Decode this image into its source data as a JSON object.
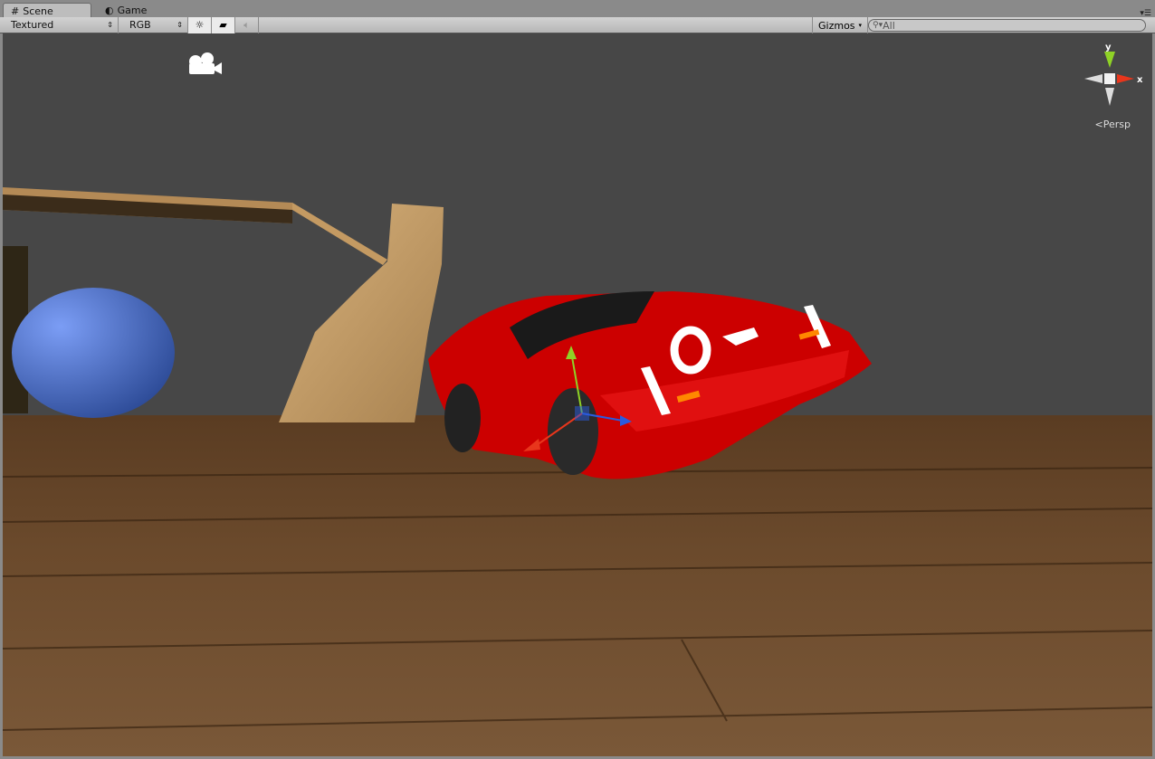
{
  "tabs": [
    {
      "label": "Scene",
      "icon": "grid-icon",
      "active": true
    },
    {
      "label": "Game",
      "icon": "pacman-icon",
      "active": false
    }
  ],
  "toolbar": {
    "render_mode": "Textured",
    "color_mode": "RGB",
    "lighting_icon": "sun-icon",
    "effects_icon": "image-icon",
    "audio_icon": "speaker-icon",
    "gizmos_label": "Gizmos",
    "search_placeholder": "All"
  },
  "scene": {
    "camera_icon": "camera-icon",
    "projection_label": "Persp",
    "axis_labels": {
      "x": "x",
      "y": "y"
    },
    "colors": {
      "background": "#474747",
      "x_axis": "#e8361c",
      "y_axis": "#8fd226",
      "z_axis": "#2a5be0",
      "car": "#d40000",
      "sphere": "#5a7ed8"
    }
  }
}
